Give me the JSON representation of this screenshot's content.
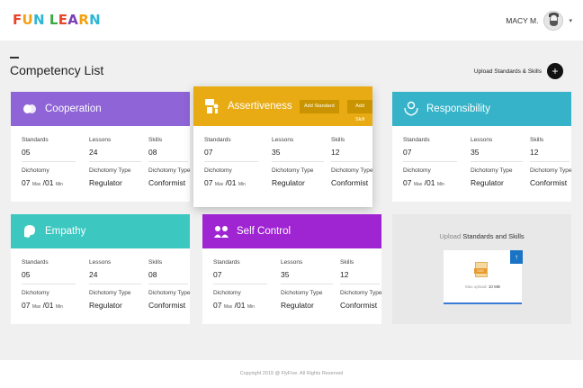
{
  "header": {
    "logo_letters": [
      "F",
      "U",
      "N",
      " ",
      "L",
      "E",
      "A",
      "R",
      "N"
    ],
    "logo_colors": [
      "#e8452b",
      "#f3a10f",
      "#2eb6d4",
      "#ffffff",
      "#3aa845",
      "#e8452b",
      "#7b3fb4",
      "#f3a10f",
      "#2eb6d4"
    ],
    "user_name": "MACY M.",
    "chevron": "▾"
  },
  "page": {
    "title": "Competency List",
    "upload_label": "Upload Standards & Skills",
    "plus_symbol": "+"
  },
  "labels": {
    "standards": "Standards",
    "lessons": "Lessons",
    "skills": "Skills",
    "dichotomy": "Dichotomy",
    "dichotomy_type": "Dichotomy Type",
    "dichotomy_type2": "Dichotomy Type",
    "max": "Max",
    "min": "Min",
    "sep": "/"
  },
  "cards": [
    {
      "name": "Cooperation",
      "color": "#8e64d6",
      "icon": "cooperation-icon",
      "standards": "05",
      "lessons": "24",
      "skills": "08",
      "dich_max": "07",
      "dich_min": "01",
      "type": "Regulator",
      "type2": "Conformist"
    },
    {
      "name": "Assertiveness",
      "color": "#e8ab14",
      "icon": "assertiveness-icon",
      "standards": "07",
      "lessons": "35",
      "skills": "12",
      "dich_max": "07",
      "dich_min": "01",
      "type": "Regulator",
      "type2": "Conformist",
      "add_standard": "Add Standard",
      "add_skill": "Add Skill"
    },
    {
      "name": "Responsibility",
      "color": "#36b3c9",
      "icon": "responsibility-icon",
      "standards": "07",
      "lessons": "35",
      "skills": "12",
      "dich_max": "07",
      "dich_min": "01",
      "type": "Regulator",
      "type2": "Conformist"
    },
    {
      "name": "Empathy",
      "color": "#3cc8c1",
      "icon": "empathy-icon",
      "standards": "05",
      "lessons": "24",
      "skills": "08",
      "dich_max": "07",
      "dich_min": "01",
      "type": "Regulator",
      "type2": "Conformist"
    },
    {
      "name": "Self Control",
      "color": "#9f25d2",
      "icon": "self-control-icon",
      "standards": "07",
      "lessons": "35",
      "skills": "12",
      "dich_max": "07",
      "dich_min": "01",
      "type": "Regulator",
      "type2": "Conformist"
    }
  ],
  "upload_card": {
    "title_soft": "Upload",
    "title_strong": "Standards and Skills",
    "file_tag": "SVG",
    "note_prefix": "Max upload:",
    "note_value": "10 MB",
    "arrow": "↑"
  },
  "footer": {
    "copyright": "Copyright 2019 @ FlyFive. All Rights Reserved"
  }
}
